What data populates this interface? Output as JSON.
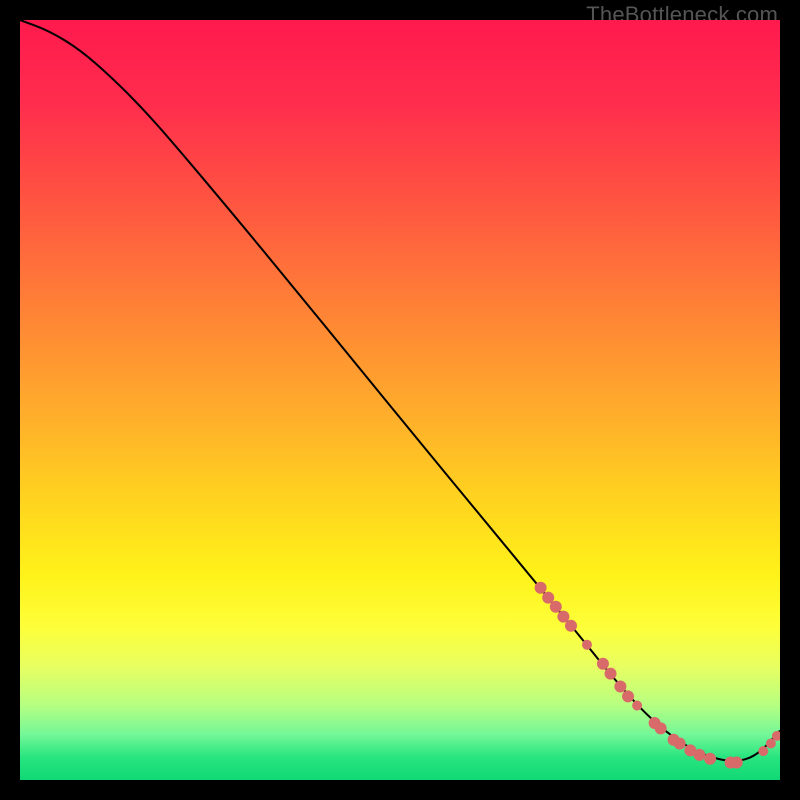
{
  "watermark": "TheBottleneck.com",
  "chart_data": {
    "type": "line",
    "title": "",
    "xlabel": "",
    "ylabel": "",
    "xlim": [
      0,
      100
    ],
    "ylim": [
      0,
      100
    ],
    "series": [
      {
        "name": "bottleneck-curve",
        "x": [
          0,
          4,
          8,
          12,
          16,
          20,
          28,
          36,
          44,
          52,
          60,
          68,
          74,
          78,
          82,
          86,
          90,
          94,
          97,
          100
        ],
        "y": [
          100,
          98.5,
          96,
          92.5,
          88.5,
          84,
          74.5,
          64.8,
          55,
          45.2,
          35.5,
          25.8,
          18.5,
          13.5,
          9,
          5.5,
          3.2,
          2.3,
          3.2,
          6.5
        ]
      }
    ],
    "markers": {
      "name": "highlight-dots",
      "color": "#d86a6a",
      "points": [
        {
          "x": 68.5,
          "y": 25.3,
          "r": 6
        },
        {
          "x": 69.5,
          "y": 24.0,
          "r": 6
        },
        {
          "x": 70.5,
          "y": 22.8,
          "r": 6
        },
        {
          "x": 71.5,
          "y": 21.5,
          "r": 6
        },
        {
          "x": 72.5,
          "y": 20.3,
          "r": 6
        },
        {
          "x": 74.6,
          "y": 17.8,
          "r": 5
        },
        {
          "x": 76.7,
          "y": 15.3,
          "r": 6
        },
        {
          "x": 77.7,
          "y": 14.0,
          "r": 6
        },
        {
          "x": 79.0,
          "y": 12.3,
          "r": 6
        },
        {
          "x": 80.0,
          "y": 11.0,
          "r": 6
        },
        {
          "x": 81.2,
          "y": 9.8,
          "r": 5
        },
        {
          "x": 83.5,
          "y": 7.5,
          "r": 6
        },
        {
          "x": 84.3,
          "y": 6.8,
          "r": 6
        },
        {
          "x": 86.0,
          "y": 5.3,
          "r": 6
        },
        {
          "x": 86.8,
          "y": 4.8,
          "r": 6
        },
        {
          "x": 88.2,
          "y": 3.9,
          "r": 6
        },
        {
          "x": 89.4,
          "y": 3.3,
          "r": 6
        },
        {
          "x": 90.8,
          "y": 2.8,
          "r": 6
        },
        {
          "x": 93.5,
          "y": 2.3,
          "r": 6
        },
        {
          "x": 94.3,
          "y": 2.3,
          "r": 6
        },
        {
          "x": 97.8,
          "y": 3.8,
          "r": 5
        },
        {
          "x": 98.8,
          "y": 4.8,
          "r": 5
        },
        {
          "x": 99.6,
          "y": 5.8,
          "r": 5
        }
      ]
    }
  }
}
